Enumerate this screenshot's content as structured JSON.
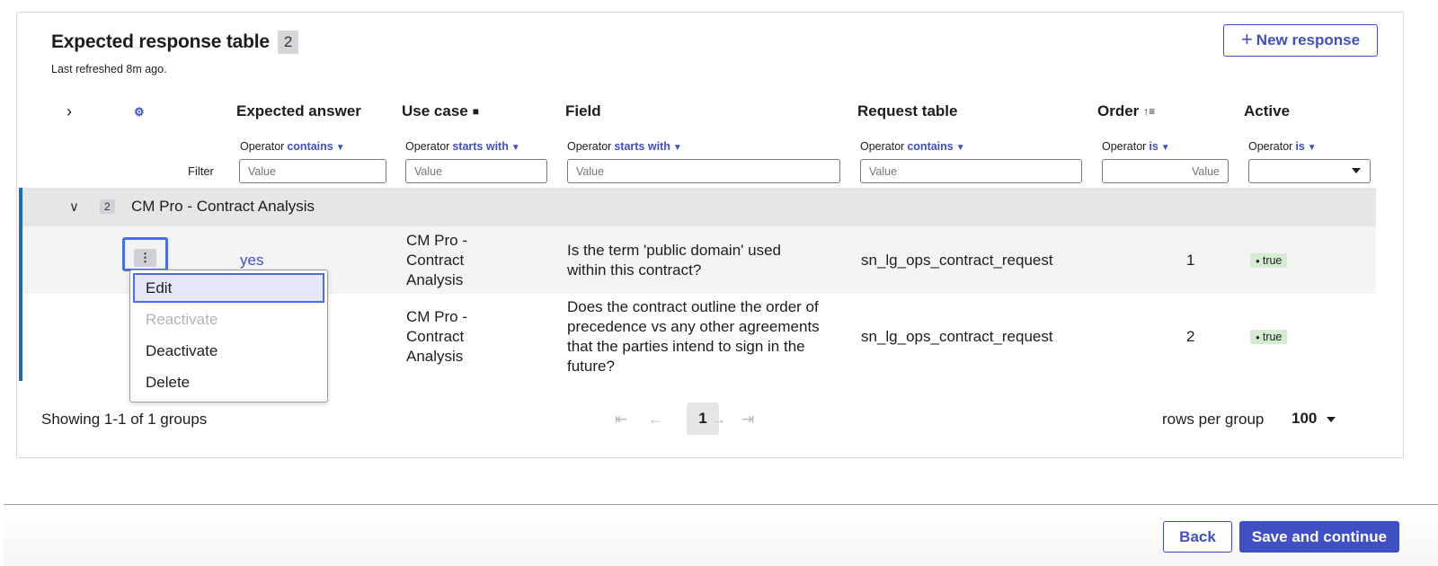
{
  "table": {
    "title": "Expected response table",
    "count": "2",
    "last_refreshed": "Last refreshed 8m ago.",
    "new_button": "New response",
    "new_button_icon": "plus-icon"
  },
  "columns": {
    "expected_answer": "Expected answer",
    "use_case": "Use case",
    "field": "Field",
    "request_table": "Request table",
    "order": "Order",
    "active": "Active"
  },
  "filters": {
    "label": "Filter",
    "operator_label": "Operator",
    "expected_answer_op": "contains",
    "use_case_op": "starts with",
    "field_op": "starts with",
    "request_table_op": "contains",
    "order_op": "is",
    "active_op": "is",
    "value_placeholder": "Value"
  },
  "group": {
    "count": "2",
    "label": "CM Pro - Contract Analysis"
  },
  "rows": [
    {
      "expected_answer": "yes",
      "use_case": "CM Pro - Contract Analysis",
      "field": "Is the term 'public domain' used within this contract?",
      "request_table": "sn_lg_ops_contract_request",
      "order": "1",
      "active": "true"
    },
    {
      "expected_answer": "",
      "use_case": "CM Pro - Contract Analysis",
      "field": "Does the contract outline the order of precedence vs any other agreements that the parties intend to sign in the future?",
      "request_table": "sn_lg_ops_contract_request",
      "order": "2",
      "active": "true"
    }
  ],
  "context_menu": {
    "items": [
      "Edit",
      "Reactivate",
      "Deactivate",
      "Delete"
    ]
  },
  "footer": {
    "showing": "Showing 1-1 of 1 groups",
    "page": "1",
    "rows_per_group_label": "rows per group",
    "rows_per_group_value": "100"
  },
  "actions": {
    "back": "Back",
    "save": "Save and continue"
  },
  "colors": {
    "accent": "#3f4fc4",
    "group_bar": "#1f6ab8",
    "true_badge": "#d5ecd0"
  }
}
